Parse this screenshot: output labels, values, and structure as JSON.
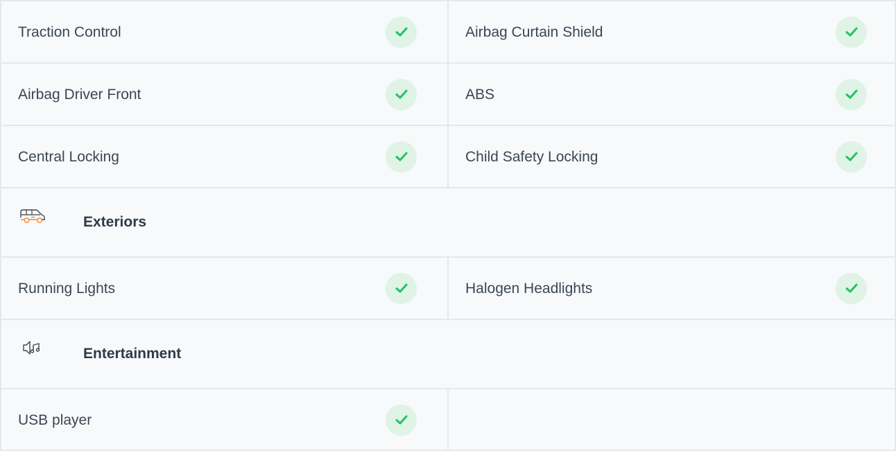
{
  "rows": [
    {
      "type": "features",
      "left": "Traction Control",
      "right": "Airbag Curtain Shield"
    },
    {
      "type": "features",
      "left": "Airbag Driver Front",
      "right": "ABS"
    },
    {
      "type": "features",
      "left": "Central Locking",
      "right": "Child Safety Locking"
    }
  ],
  "sections": {
    "exteriors": {
      "title": "Exteriors",
      "icon": "car-icon",
      "items": [
        {
          "left": "Running Lights",
          "right": "Halogen Headlights"
        }
      ]
    },
    "entertainment": {
      "title": "Entertainment",
      "icon": "speaker-music-icon",
      "items": [
        {
          "left": "USB player",
          "right": ""
        }
      ]
    }
  },
  "colors": {
    "check": "#22c35e",
    "check_bg": "#dff3e7",
    "icon_orange": "#f0872f",
    "border": "#e3e8ee",
    "background": "#f7f9fb"
  }
}
